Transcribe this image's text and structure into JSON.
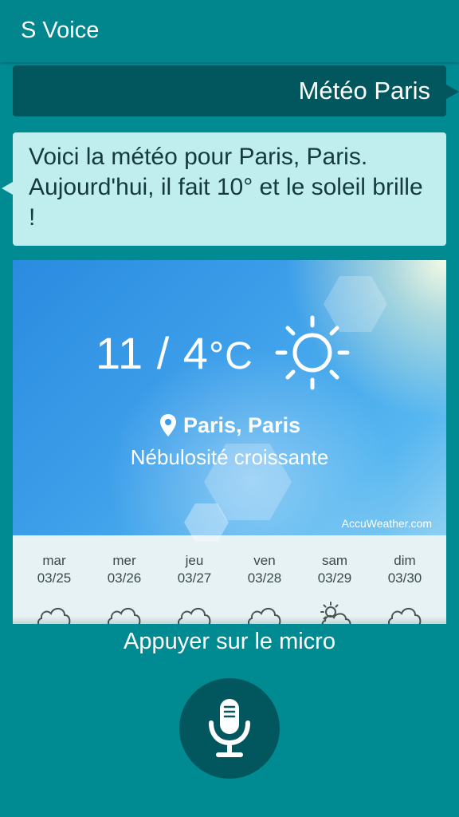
{
  "app": {
    "title": "S Voice"
  },
  "conversation": {
    "user_query": "Météo Paris",
    "reply": "Voici la météo pour Paris, Paris. Aujourd'hui, il fait 10° et le soleil brille !"
  },
  "weather": {
    "temperature": "11 / 4",
    "unit": "°C",
    "location": "Paris, Paris",
    "condition": "Nébulosité croissante",
    "source": "AccuWeather.com",
    "current_icon": "sun-icon",
    "forecast": [
      {
        "day": "mar",
        "date": "03/25",
        "icon": "cloud-icon"
      },
      {
        "day": "mer",
        "date": "03/26",
        "icon": "cloud-icon"
      },
      {
        "day": "jeu",
        "date": "03/27",
        "icon": "cloud-icon"
      },
      {
        "day": "ven",
        "date": "03/28",
        "icon": "cloud-icon"
      },
      {
        "day": "sam",
        "date": "03/29",
        "icon": "partly-sunny-icon"
      },
      {
        "day": "dim",
        "date": "03/30",
        "icon": "cloud-icon"
      }
    ]
  },
  "footer": {
    "prompt": "Appuyer sur le micro",
    "mic_icon": "microphone-icon"
  },
  "colors": {
    "background": "#008a91",
    "user_bubble": "#02575e",
    "reply_bubble": "#c0eeee",
    "mic_button": "#02575e"
  }
}
